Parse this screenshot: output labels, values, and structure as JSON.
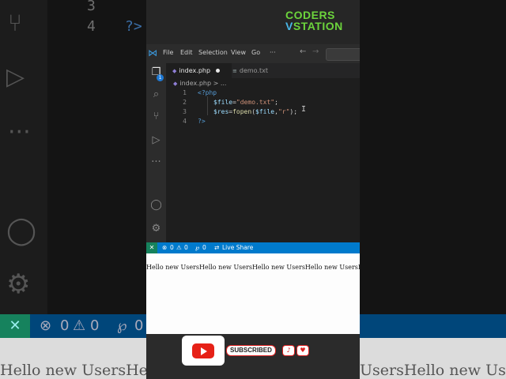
{
  "logo": {
    "line1": "CODERS",
    "line2_v": "V",
    "line2_rest": "STATION"
  },
  "background": {
    "line_numbers": [
      "3",
      "4"
    ],
    "code_fragment": "?>",
    "status_counts": [
      "0",
      "0",
      "0"
    ],
    "output_left": "Hello new UsersHello ne",
    "output_right": "UsersHello new Users"
  },
  "menu": {
    "items": [
      "File",
      "Edit",
      "Selection",
      "View",
      "Go",
      "···"
    ]
  },
  "activity": {
    "badge": "1"
  },
  "tabs": [
    {
      "label": "index.php",
      "modified": true
    },
    {
      "label": "demo.txt",
      "modified": false
    }
  ],
  "breadcrumb": {
    "file": "index.php",
    "rest": "> ..."
  },
  "code": {
    "line_numbers": [
      "1",
      "2",
      "3",
      "4"
    ],
    "line1": "<?php",
    "line2": {
      "var": "$file",
      "eq": "=",
      "str": "\"demo.txt\"",
      "end": ";"
    },
    "line3": {
      "var": "$res",
      "eq": "=",
      "fn": "fopen",
      "open": "(",
      "arg1": "$file",
      "comma": ",",
      "arg2": "\"r\"",
      "close": ");"
    },
    "line4": "?>"
  },
  "statusbar": {
    "errors": "0",
    "warnings": "0",
    "ports": "0",
    "live_share": "Live Share"
  },
  "output": {
    "text": "Hello new UsersHello new UsersHello new UsersHello new UsersHello new UsersHello new Users"
  },
  "subscribe": {
    "label": "SUBSCRIBED"
  },
  "colors": {
    "accent": "#007acc",
    "remote": "#16825d",
    "logo_green": "#6cd43c",
    "logo_blue": "#49b7e8",
    "youtube_red": "#e62117"
  }
}
